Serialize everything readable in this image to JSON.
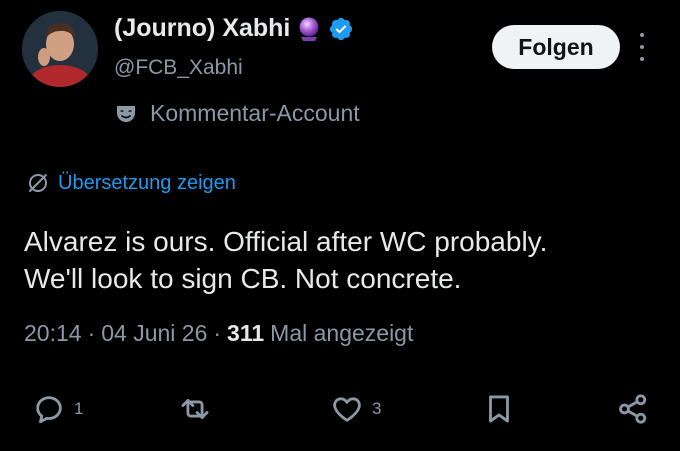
{
  "author": {
    "display_name": "(Journo) Xabhi",
    "handle": "@FCB_Xabhi",
    "affiliate_badge": "crystal-ball-emoji",
    "verified": true
  },
  "follow_button": {
    "label": "Folgen"
  },
  "automated_label": "Kommentar-Account",
  "translate_link": "Übersetzung zeigen",
  "tweet": {
    "lines": [
      "Alvarez is ours. Official after WC probably.",
      "We'll look to sign CB. Not concrete."
    ]
  },
  "meta": {
    "time": "20:14",
    "date": "04 Juni 26",
    "views_count": "311",
    "views_label": "Mal angezeigt",
    "separator": "·"
  },
  "actions": {
    "reply_count": "1",
    "like_count": "3"
  },
  "colors": {
    "background": "#000000",
    "text": "#e7e9ea",
    "secondary": "#8b98a5",
    "link": "#1d9bf0",
    "verified": "#1d9bf0"
  }
}
